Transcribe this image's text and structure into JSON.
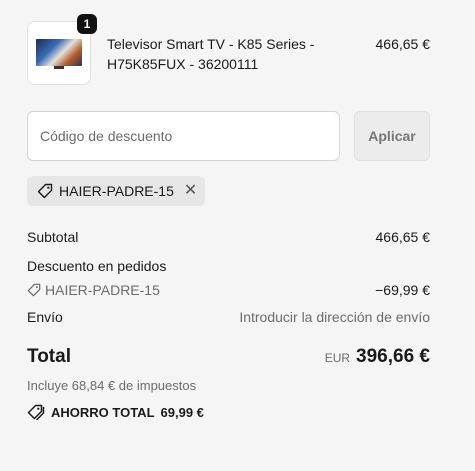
{
  "product": {
    "quantity": "1",
    "name": "Televisor Smart TV - K85 Series - H75K85FUX - 36200111",
    "price": "466,65 €"
  },
  "discount": {
    "placeholder": "Código de descuento",
    "apply_label": "Aplicar",
    "applied_code": "HAIER-PADRE-15"
  },
  "summary": {
    "subtotal_label": "Subtotal",
    "subtotal_value": "466,65 €",
    "order_discount_label": "Descuento en pedidos",
    "order_discount_code": "HAIER-PADRE-15",
    "order_discount_value": "−69,99 €",
    "shipping_label": "Envío",
    "shipping_value": "Introducir la dirección de envío",
    "total_label": "Total",
    "total_currency": "EUR",
    "total_value": "396,66 €",
    "taxes_note": "Incluye 68,84 € de impuestos",
    "savings_label": "AHORRO TOTAL",
    "savings_value": "69,99 €"
  },
  "icons": {
    "tag": "tag-icon",
    "close": "close-icon",
    "savings": "double-tag-icon"
  }
}
